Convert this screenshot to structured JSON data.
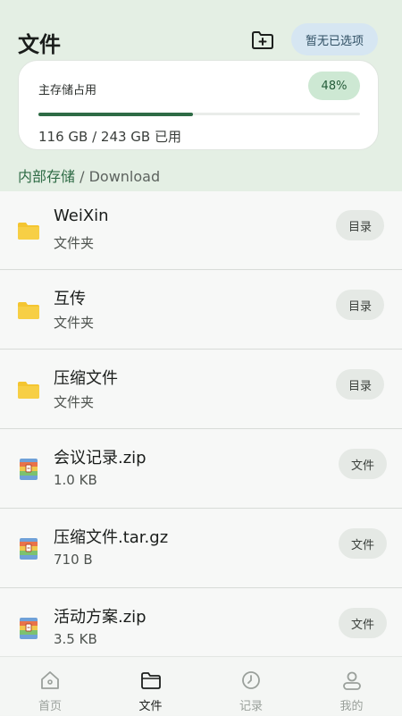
{
  "header": {
    "title": "文件",
    "new_folder_icon": "folder-plus-icon",
    "selection_status": "暂无已选项"
  },
  "storage": {
    "label": "主存储占用",
    "percent_text": "48%",
    "used_fraction": 0.48,
    "used_text": "116 GB / 243 GB 已用"
  },
  "breadcrumb": {
    "root": "内部存储",
    "separator": "/",
    "current": "Download"
  },
  "files": [
    {
      "name": "WeiXin",
      "sub": "文件夹",
      "tag": "目录",
      "icon": "folder-icon"
    },
    {
      "name": "互传",
      "sub": "文件夹",
      "tag": "目录",
      "icon": "folder-icon"
    },
    {
      "name": "压缩文件",
      "sub": "文件夹",
      "tag": "目录",
      "icon": "folder-icon"
    },
    {
      "name": "会议记录.zip",
      "sub": "1.0 KB",
      "tag": "文件",
      "icon": "archive-icon"
    },
    {
      "name": "压缩文件.tar.gz",
      "sub": "710 B",
      "tag": "文件",
      "icon": "archive-icon"
    },
    {
      "name": "活动方案.zip",
      "sub": "3.5 KB",
      "tag": "文件",
      "icon": "archive-icon"
    }
  ],
  "nav": {
    "items": [
      {
        "label": "首页",
        "icon": "home-icon"
      },
      {
        "label": "文件",
        "icon": "folder-icon"
      },
      {
        "label": "记录",
        "icon": "clock-icon"
      },
      {
        "label": "我的",
        "icon": "profile-icon"
      }
    ],
    "active_index": 1
  },
  "colors": {
    "accent": "#2e6b45",
    "header_bg": "#e4efe4",
    "folder_yellow": "#f4c531"
  }
}
